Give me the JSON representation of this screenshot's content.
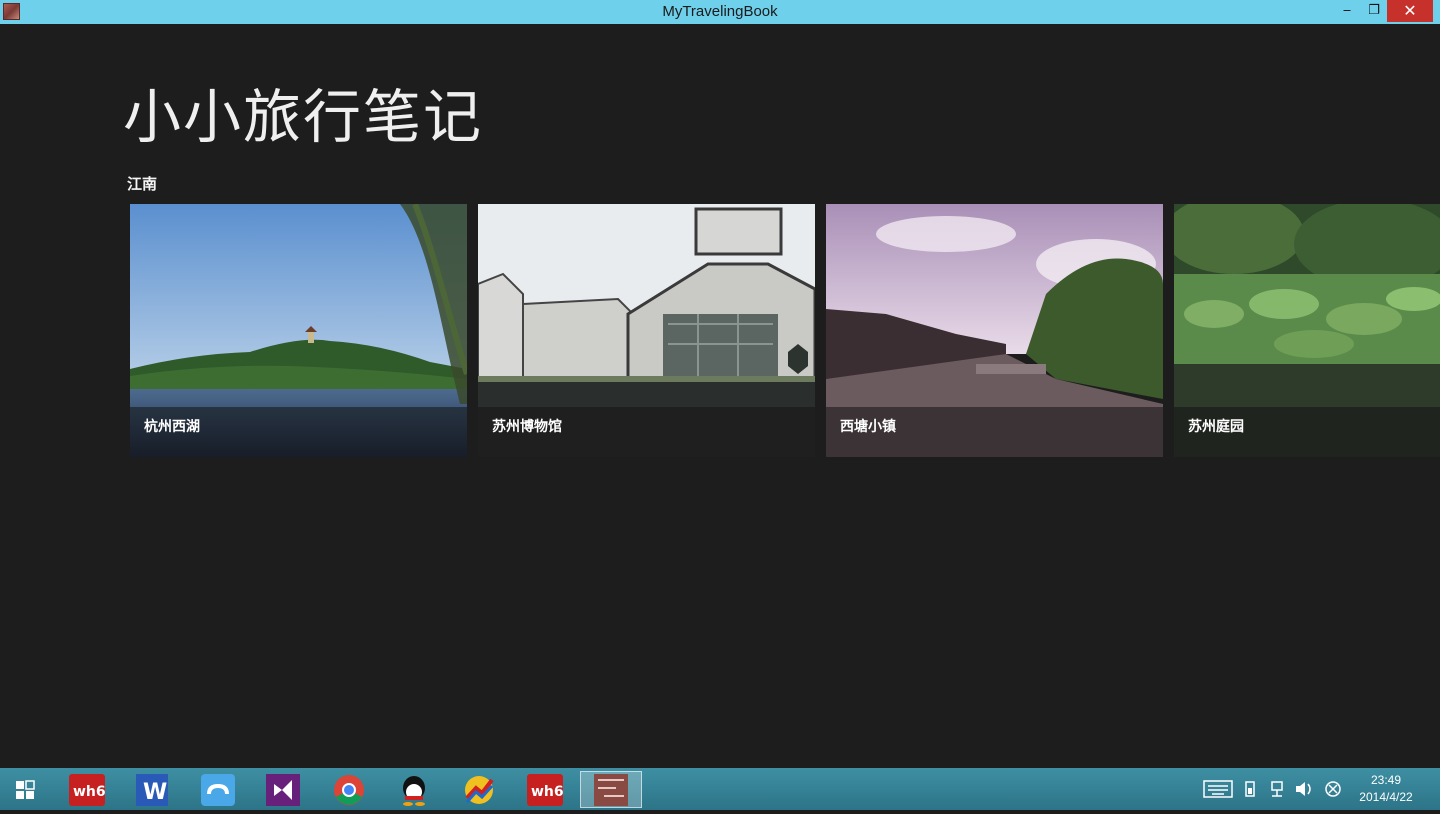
{
  "window": {
    "title": "MyTravelingBook",
    "buttons": {
      "minimize": "‒",
      "maximize": "❐",
      "close": "✕"
    }
  },
  "page": {
    "title": "小小旅行笔记",
    "group": {
      "header": "江南",
      "items": [
        {
          "caption": "杭州西湖"
        },
        {
          "caption": "苏州博物馆"
        },
        {
          "caption": "西塘小镇"
        },
        {
          "caption": "苏州庭园"
        }
      ]
    }
  },
  "taskbar": {
    "apps": [
      {
        "icon": "start-icon"
      },
      {
        "icon": "wh6-icon",
        "label": "wh6"
      },
      {
        "icon": "word-icon",
        "label": "W"
      },
      {
        "icon": "baidu-cloud-icon"
      },
      {
        "icon": "visual-studio-icon"
      },
      {
        "icon": "chrome-icon"
      },
      {
        "icon": "qq-icon"
      },
      {
        "icon": "stock-app-icon"
      },
      {
        "icon": "wh6-icon",
        "label": "wh6"
      },
      {
        "icon": "my-traveling-book-icon"
      }
    ],
    "tray": {
      "time": "23:49",
      "date": "2014/4/22"
    }
  }
}
